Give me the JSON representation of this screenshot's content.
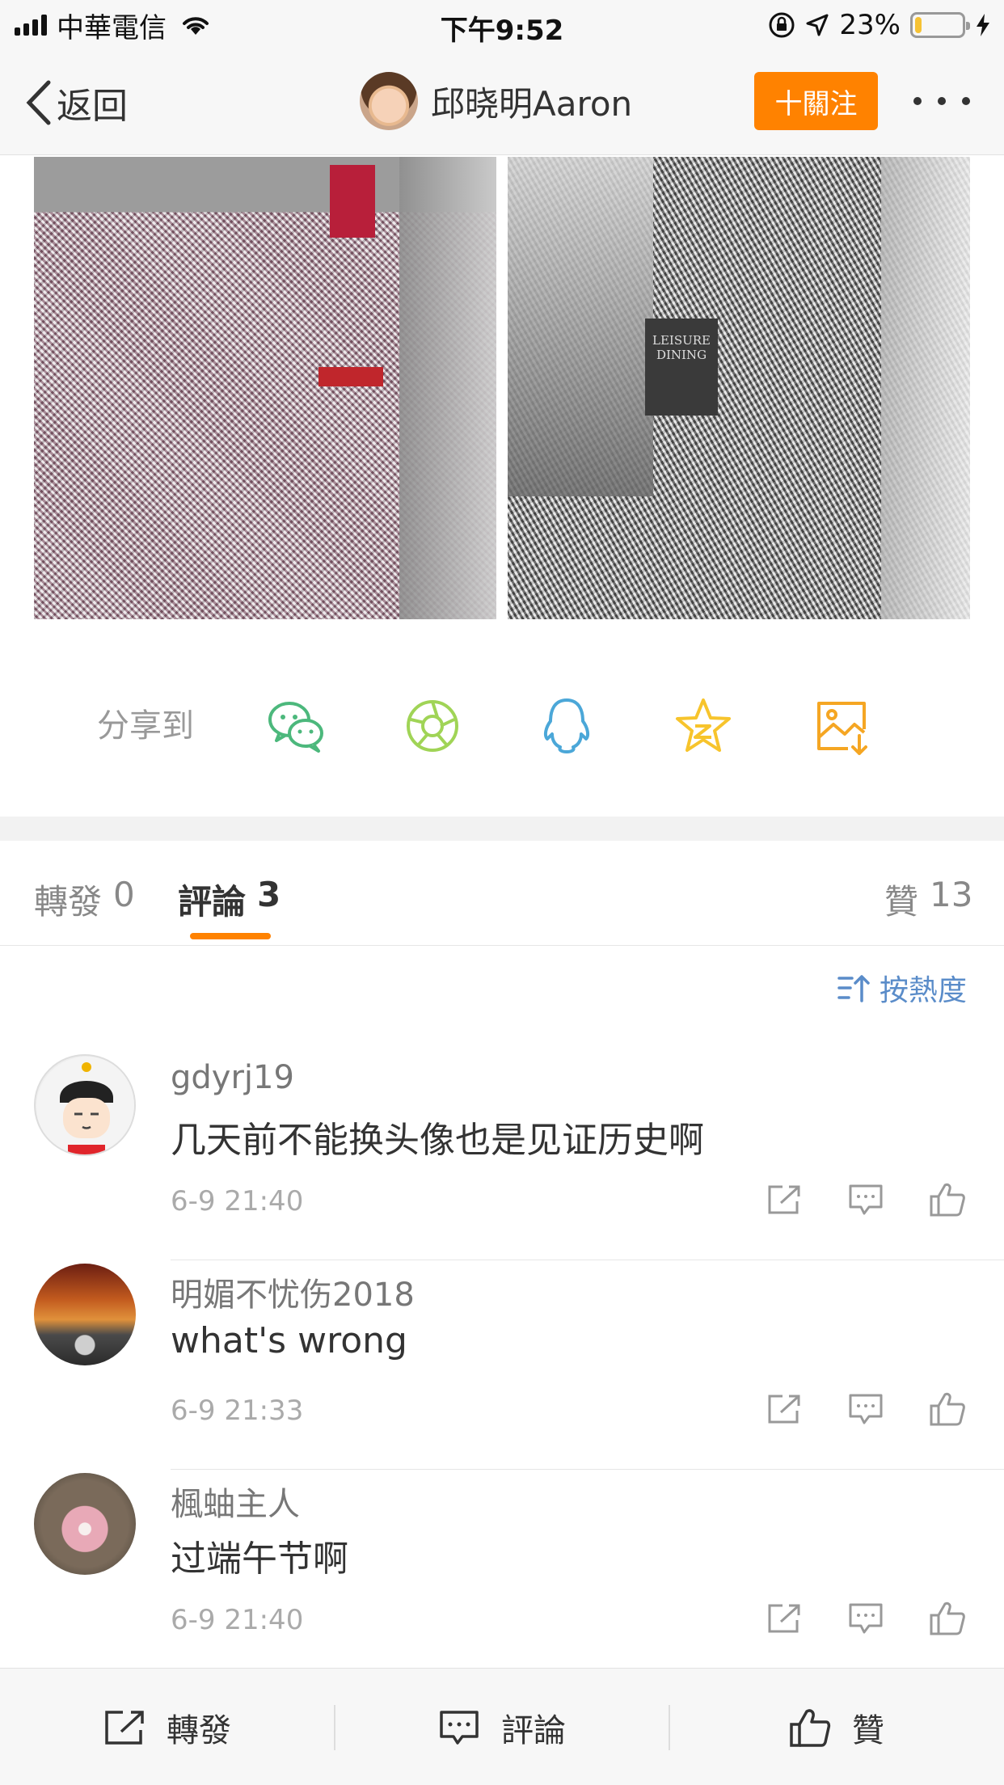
{
  "status_bar": {
    "carrier": "中華電信",
    "time": "下午9:52",
    "battery_percent": "23%",
    "battery_level": 0.23,
    "battery_color": "#f6c234"
  },
  "nav": {
    "back_label": "返回",
    "title": "邱晓明Aaron",
    "follow_label": "十關注",
    "follow_color": "#ff8200"
  },
  "photos": [
    {
      "text": ""
    },
    {
      "text": "LEISURE DINING"
    }
  ],
  "share": {
    "label": "分享到",
    "icons": [
      "wechat-icon",
      "moments-icon",
      "qq-icon",
      "qzone-icon",
      "save-image-icon"
    ],
    "colors": [
      "#4cb87c",
      "#a0d456",
      "#4ba7d8",
      "#f7c42c",
      "#f5a623"
    ]
  },
  "tabs": {
    "repost_label": "轉發",
    "repost_count": "0",
    "comment_label": "評論",
    "comment_count": "3",
    "like_label": "贊",
    "like_count": "13"
  },
  "sort": {
    "label": "按熱度"
  },
  "comments": [
    {
      "user": "gdyrj19",
      "text": "几天前不能换头像也是见证历史啊",
      "time": "6-9 21:40"
    },
    {
      "user": "明媚不忧伤2018",
      "text": "what's wrong",
      "time": "6-9 21:33"
    },
    {
      "user": "楓蚰主人",
      "text": "过端午节啊",
      "time": "6-9 21:40"
    }
  ],
  "bottom_bar": {
    "repost_label": "轉發",
    "comment_label": "評論",
    "like_label": "贊"
  }
}
